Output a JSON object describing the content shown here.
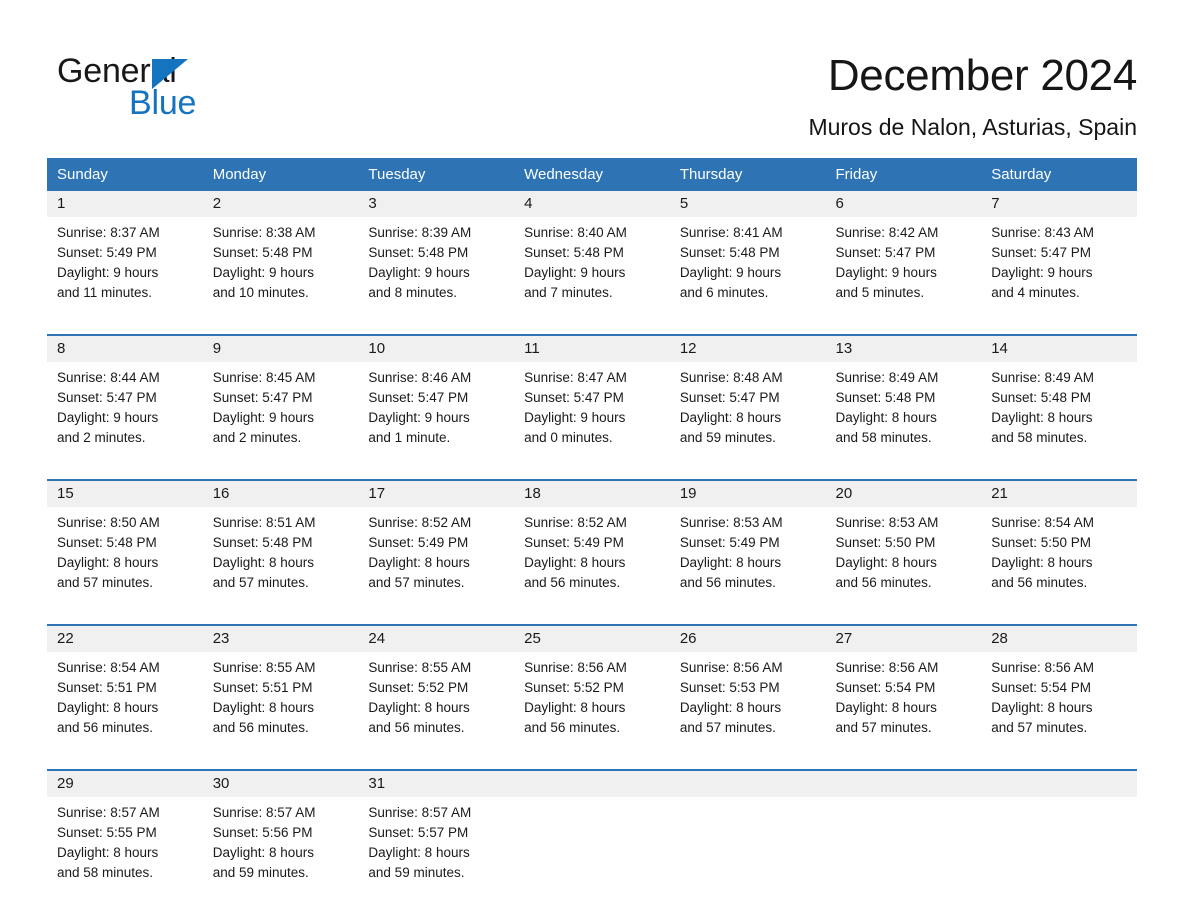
{
  "brand": {
    "name_part1": "General",
    "name_part2": "Blue",
    "triangle_color": "#1574bf"
  },
  "header": {
    "title": "December 2024",
    "subtitle": "Muros de Nalon, Asturias, Spain"
  },
  "theme": {
    "header_blue": "#2e74b5",
    "daynum_band": "#f0f0f0",
    "text": "#1a1a1a"
  },
  "weekdays": [
    "Sunday",
    "Monday",
    "Tuesday",
    "Wednesday",
    "Thursday",
    "Friday",
    "Saturday"
  ],
  "weeks": [
    [
      {
        "day": "1",
        "lines": [
          "Sunrise: 8:37 AM",
          "Sunset: 5:49 PM",
          "Daylight: 9 hours",
          "and 11 minutes."
        ]
      },
      {
        "day": "2",
        "lines": [
          "Sunrise: 8:38 AM",
          "Sunset: 5:48 PM",
          "Daylight: 9 hours",
          "and 10 minutes."
        ]
      },
      {
        "day": "3",
        "lines": [
          "Sunrise: 8:39 AM",
          "Sunset: 5:48 PM",
          "Daylight: 9 hours",
          "and 8 minutes."
        ]
      },
      {
        "day": "4",
        "lines": [
          "Sunrise: 8:40 AM",
          "Sunset: 5:48 PM",
          "Daylight: 9 hours",
          "and 7 minutes."
        ]
      },
      {
        "day": "5",
        "lines": [
          "Sunrise: 8:41 AM",
          "Sunset: 5:48 PM",
          "Daylight: 9 hours",
          "and 6 minutes."
        ]
      },
      {
        "day": "6",
        "lines": [
          "Sunrise: 8:42 AM",
          "Sunset: 5:47 PM",
          "Daylight: 9 hours",
          "and 5 minutes."
        ]
      },
      {
        "day": "7",
        "lines": [
          "Sunrise: 8:43 AM",
          "Sunset: 5:47 PM",
          "Daylight: 9 hours",
          "and 4 minutes."
        ]
      }
    ],
    [
      {
        "day": "8",
        "lines": [
          "Sunrise: 8:44 AM",
          "Sunset: 5:47 PM",
          "Daylight: 9 hours",
          "and 2 minutes."
        ]
      },
      {
        "day": "9",
        "lines": [
          "Sunrise: 8:45 AM",
          "Sunset: 5:47 PM",
          "Daylight: 9 hours",
          "and 2 minutes."
        ]
      },
      {
        "day": "10",
        "lines": [
          "Sunrise: 8:46 AM",
          "Sunset: 5:47 PM",
          "Daylight: 9 hours",
          "and 1 minute."
        ]
      },
      {
        "day": "11",
        "lines": [
          "Sunrise: 8:47 AM",
          "Sunset: 5:47 PM",
          "Daylight: 9 hours",
          "and 0 minutes."
        ]
      },
      {
        "day": "12",
        "lines": [
          "Sunrise: 8:48 AM",
          "Sunset: 5:47 PM",
          "Daylight: 8 hours",
          "and 59 minutes."
        ]
      },
      {
        "day": "13",
        "lines": [
          "Sunrise: 8:49 AM",
          "Sunset: 5:48 PM",
          "Daylight: 8 hours",
          "and 58 minutes."
        ]
      },
      {
        "day": "14",
        "lines": [
          "Sunrise: 8:49 AM",
          "Sunset: 5:48 PM",
          "Daylight: 8 hours",
          "and 58 minutes."
        ]
      }
    ],
    [
      {
        "day": "15",
        "lines": [
          "Sunrise: 8:50 AM",
          "Sunset: 5:48 PM",
          "Daylight: 8 hours",
          "and 57 minutes."
        ]
      },
      {
        "day": "16",
        "lines": [
          "Sunrise: 8:51 AM",
          "Sunset: 5:48 PM",
          "Daylight: 8 hours",
          "and 57 minutes."
        ]
      },
      {
        "day": "17",
        "lines": [
          "Sunrise: 8:52 AM",
          "Sunset: 5:49 PM",
          "Daylight: 8 hours",
          "and 57 minutes."
        ]
      },
      {
        "day": "18",
        "lines": [
          "Sunrise: 8:52 AM",
          "Sunset: 5:49 PM",
          "Daylight: 8 hours",
          "and 56 minutes."
        ]
      },
      {
        "day": "19",
        "lines": [
          "Sunrise: 8:53 AM",
          "Sunset: 5:49 PM",
          "Daylight: 8 hours",
          "and 56 minutes."
        ]
      },
      {
        "day": "20",
        "lines": [
          "Sunrise: 8:53 AM",
          "Sunset: 5:50 PM",
          "Daylight: 8 hours",
          "and 56 minutes."
        ]
      },
      {
        "day": "21",
        "lines": [
          "Sunrise: 8:54 AM",
          "Sunset: 5:50 PM",
          "Daylight: 8 hours",
          "and 56 minutes."
        ]
      }
    ],
    [
      {
        "day": "22",
        "lines": [
          "Sunrise: 8:54 AM",
          "Sunset: 5:51 PM",
          "Daylight: 8 hours",
          "and 56 minutes."
        ]
      },
      {
        "day": "23",
        "lines": [
          "Sunrise: 8:55 AM",
          "Sunset: 5:51 PM",
          "Daylight: 8 hours",
          "and 56 minutes."
        ]
      },
      {
        "day": "24",
        "lines": [
          "Sunrise: 8:55 AM",
          "Sunset: 5:52 PM",
          "Daylight: 8 hours",
          "and 56 minutes."
        ]
      },
      {
        "day": "25",
        "lines": [
          "Sunrise: 8:56 AM",
          "Sunset: 5:52 PM",
          "Daylight: 8 hours",
          "and 56 minutes."
        ]
      },
      {
        "day": "26",
        "lines": [
          "Sunrise: 8:56 AM",
          "Sunset: 5:53 PM",
          "Daylight: 8 hours",
          "and 57 minutes."
        ]
      },
      {
        "day": "27",
        "lines": [
          "Sunrise: 8:56 AM",
          "Sunset: 5:54 PM",
          "Daylight: 8 hours",
          "and 57 minutes."
        ]
      },
      {
        "day": "28",
        "lines": [
          "Sunrise: 8:56 AM",
          "Sunset: 5:54 PM",
          "Daylight: 8 hours",
          "and 57 minutes."
        ]
      }
    ],
    [
      {
        "day": "29",
        "lines": [
          "Sunrise: 8:57 AM",
          "Sunset: 5:55 PM",
          "Daylight: 8 hours",
          "and 58 minutes."
        ]
      },
      {
        "day": "30",
        "lines": [
          "Sunrise: 8:57 AM",
          "Sunset: 5:56 PM",
          "Daylight: 8 hours",
          "and 59 minutes."
        ]
      },
      {
        "day": "31",
        "lines": [
          "Sunrise: 8:57 AM",
          "Sunset: 5:57 PM",
          "Daylight: 8 hours",
          "and 59 minutes."
        ]
      },
      {
        "day": "",
        "lines": []
      },
      {
        "day": "",
        "lines": []
      },
      {
        "day": "",
        "lines": []
      },
      {
        "day": "",
        "lines": []
      }
    ]
  ]
}
